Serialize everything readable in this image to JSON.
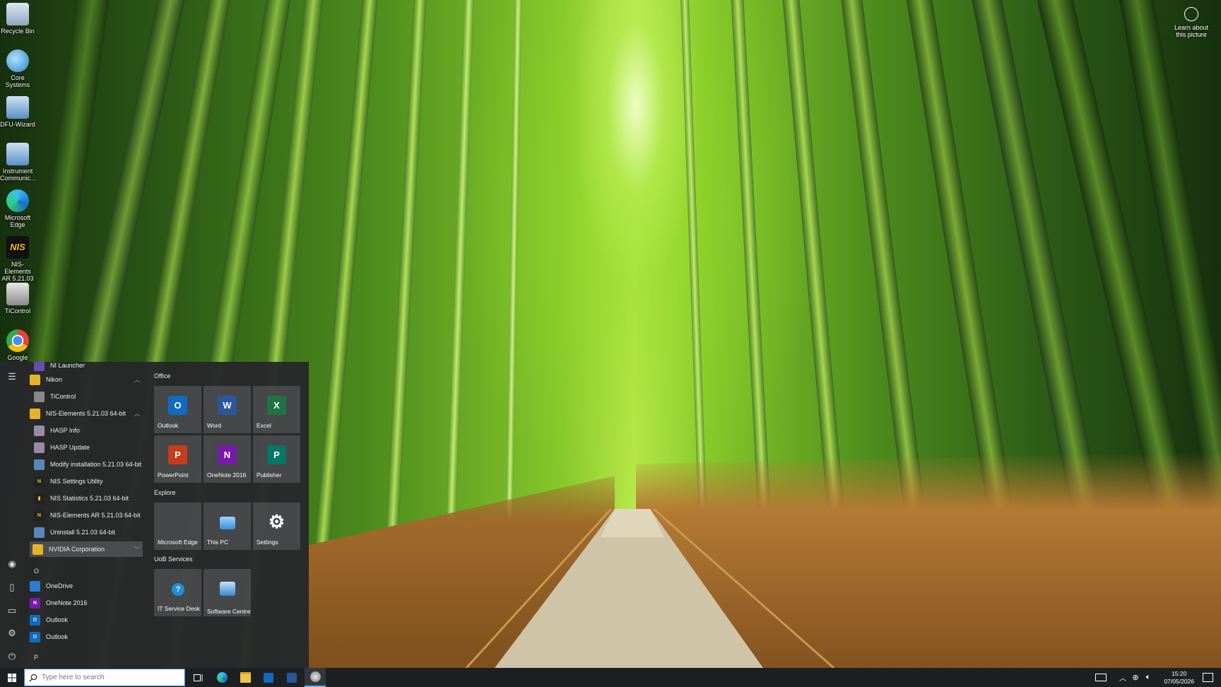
{
  "wallpaper": {
    "learn_label": "Learn about this picture"
  },
  "desktop_icons": [
    {
      "label": "Recycle Bin"
    },
    {
      "label": "Core Systems"
    },
    {
      "label": "DFU-Wizard"
    },
    {
      "label": "Instrument Communic..."
    },
    {
      "label": "Microsoft Edge"
    },
    {
      "label": "NIS-Elements AR 5.21.03 ..."
    },
    {
      "label": "TiControl"
    },
    {
      "label": "Google"
    }
  ],
  "start_menu": {
    "app_list": [
      {
        "label": "NI Launcher",
        "kind": "app"
      },
      {
        "label": "Nikon",
        "kind": "folder",
        "chevron": "^"
      },
      {
        "label": "TiControl",
        "kind": "sub"
      },
      {
        "label": "NIS-Elements 5.21.03 64-bit",
        "kind": "folder",
        "chevron": "^"
      },
      {
        "label": "HASP Info",
        "kind": "sub"
      },
      {
        "label": "HASP Update",
        "kind": "sub"
      },
      {
        "label": "Modify installation 5.21.03 64-bit",
        "kind": "sub"
      },
      {
        "label": "NIS Settings Utility",
        "kind": "sub"
      },
      {
        "label": "NIS Statistics 5.21.03 64-bit",
        "kind": "sub"
      },
      {
        "label": "NIS-Elements AR 5.21.03 64-bit",
        "kind": "sub"
      },
      {
        "label": "Uninstall 5.21.03 64-bit",
        "kind": "sub"
      },
      {
        "label": "NVIDIA Corporation",
        "kind": "folder",
        "chevron": "v"
      },
      {
        "label": "O",
        "kind": "letter"
      },
      {
        "label": "OneDrive",
        "kind": "app"
      },
      {
        "label": "OneNote 2016",
        "kind": "app"
      },
      {
        "label": "Outlook",
        "kind": "app"
      },
      {
        "label": "Outlook",
        "kind": "app"
      },
      {
        "label": "P",
        "kind": "letter"
      }
    ],
    "groups": [
      {
        "title": "Office"
      },
      {
        "title": "Explore"
      },
      {
        "title": "UoB Services"
      }
    ],
    "tiles": [
      {
        "label": "Outlook",
        "glyph": "O"
      },
      {
        "label": "Word",
        "glyph": "W"
      },
      {
        "label": "Excel",
        "glyph": "X"
      },
      {
        "label": "PowerPoint",
        "glyph": "P"
      },
      {
        "label": "OneNote 2016",
        "glyph": "N"
      },
      {
        "label": "Publisher",
        "glyph": "P"
      },
      {
        "label": "Microsoft Edge",
        "glyph": ""
      },
      {
        "label": "This PC",
        "glyph": ""
      },
      {
        "label": "Settings",
        "glyph": "⚙"
      },
      {
        "label": "IT Service Desk",
        "glyph": "?"
      },
      {
        "label": "Software Centre",
        "glyph": ""
      }
    ]
  },
  "taskbar": {
    "search_placeholder": "Type here to search",
    "time": "15:20",
    "date": "07/05/2026"
  },
  "colors": {
    "outlook": "#0f6cbd",
    "word": "#2b579a",
    "excel": "#217346",
    "powerpoint": "#c43e1c",
    "onenote": "#7719aa",
    "publisher": "#077568",
    "start_bg": "#26282a",
    "taskbar_bg": "#1d2023"
  }
}
